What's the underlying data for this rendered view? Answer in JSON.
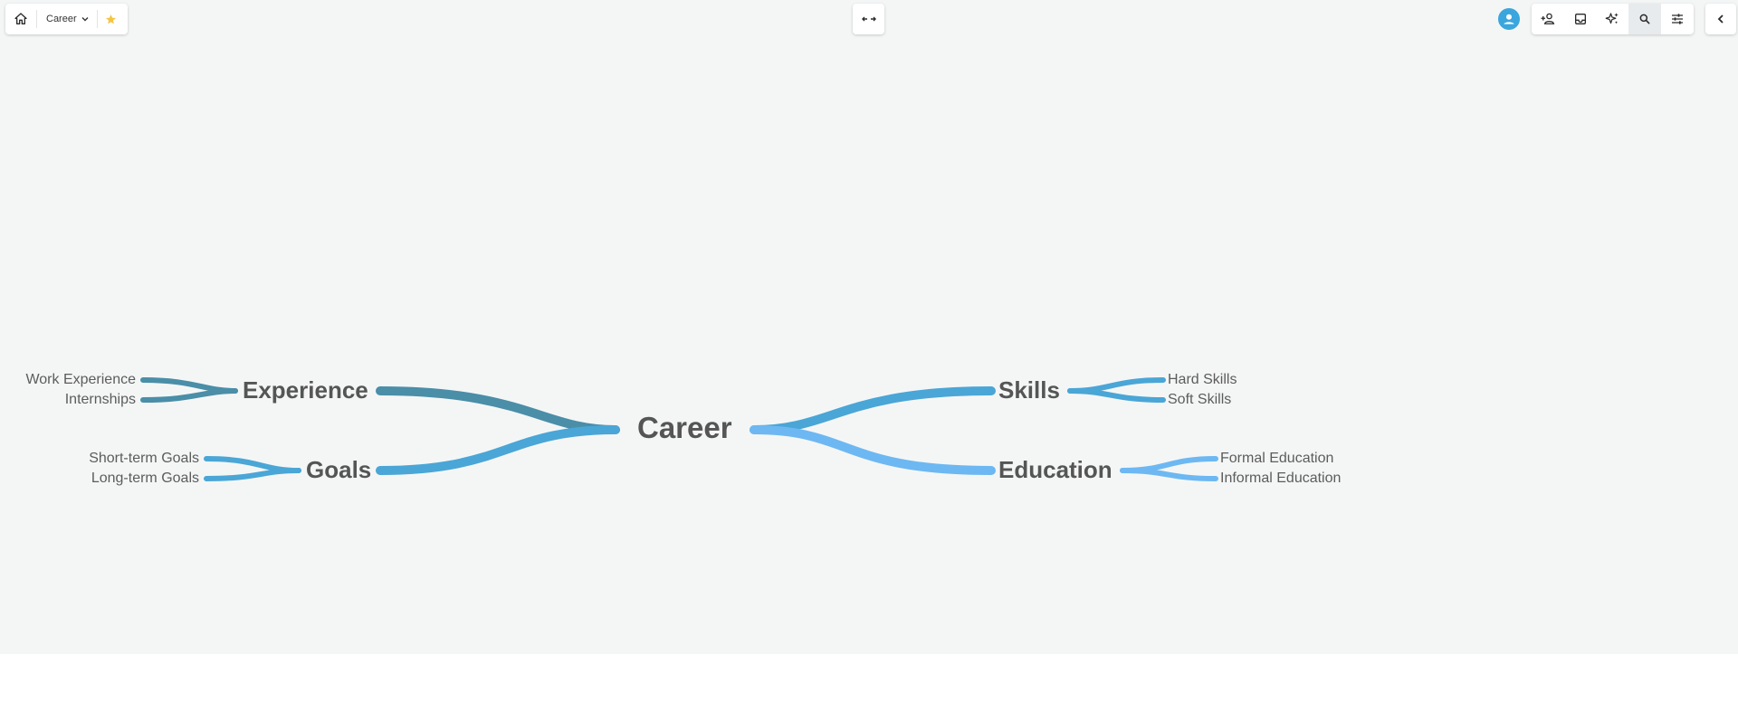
{
  "toolbar": {
    "document_title": "Career",
    "icons": {
      "home": "home-icon",
      "dropdown": "chevron-down-icon",
      "favorite": "star-icon",
      "fit_view": "fit-width-icon",
      "avatar": "user-avatar-icon",
      "share": "add-person-icon",
      "inbox": "inbox-icon",
      "ai": "sparkle-icon",
      "search": "search-icon",
      "settings": "sliders-icon",
      "collapse": "chevron-left-icon"
    },
    "colors": {
      "star": "#f4c542",
      "avatar": "#3aa6dd",
      "active_button_bg": "#e8ebee"
    }
  },
  "mindmap": {
    "root": {
      "label": "Career"
    },
    "left_branches": [
      {
        "label": "Experience",
        "color": "#4a8ea8",
        "children": [
          "Work Experience",
          "Internships"
        ]
      },
      {
        "label": "Goals",
        "color": "#4aa6d6",
        "children": [
          "Short-term Goals",
          "Long-term Goals"
        ]
      }
    ],
    "right_branches": [
      {
        "label": "Skills",
        "color": "#4aa6d6",
        "children": [
          "Hard Skills",
          "Soft Skills"
        ]
      },
      {
        "label": "Education",
        "color": "#6db8f2",
        "children": [
          "Formal Education",
          "Informal Education"
        ]
      }
    ]
  }
}
